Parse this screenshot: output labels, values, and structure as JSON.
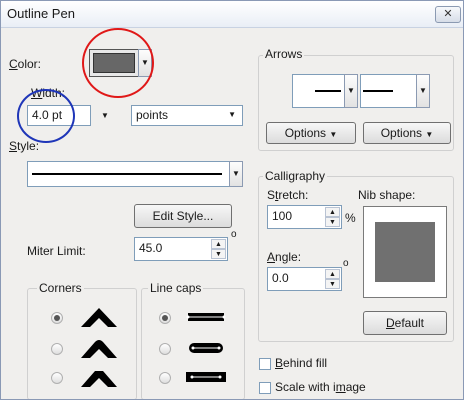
{
  "window": {
    "title": "Outline Pen",
    "close_label": "✕"
  },
  "color": {
    "label": "Color:",
    "swatch": "#676767",
    "ring": "#e01818"
  },
  "width": {
    "label": "Width:",
    "value": "4.0 pt",
    "unit": "points",
    "ring": "#1f36b8"
  },
  "style": {
    "label": "Style:",
    "edit_button": "Edit Style..."
  },
  "miter": {
    "label": "Miter Limit:",
    "value": "45.0",
    "degree": "o"
  },
  "corners": {
    "title": "Corners",
    "selected_index": 0
  },
  "linecaps": {
    "title": "Line caps",
    "selected_index": 0
  },
  "arrows": {
    "title": "Arrows",
    "options_left": "Options",
    "options_right": "Options"
  },
  "calligraphy": {
    "title": "Calligraphy",
    "stretch_label": "Stretch:",
    "stretch_value": "100",
    "percent": "%",
    "nib_label": "Nib shape:",
    "angle_label": "Angle:",
    "angle_value": "0.0",
    "degree": "o",
    "default_button": "Default",
    "nib_color": "#707070"
  },
  "options": {
    "behind_fill": "Behind fill",
    "scale_with_image": "Scale with image"
  }
}
